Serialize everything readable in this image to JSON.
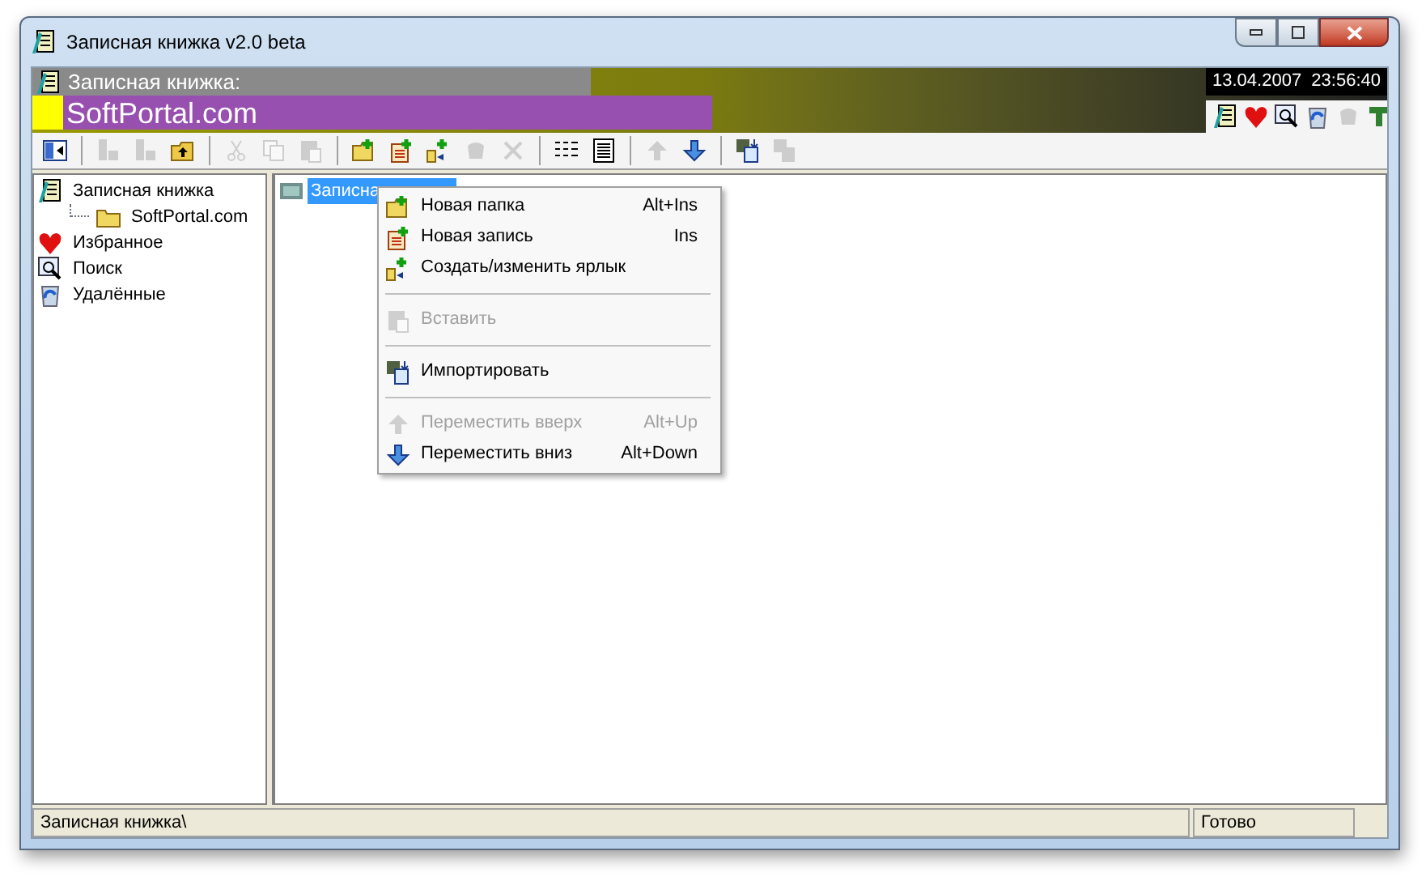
{
  "window": {
    "title": "Записная книжка v2.0 beta"
  },
  "banner": {
    "caption": "Записная книжка:",
    "name": "SoftPortal.com",
    "datetime": "13.04.2007  23:56:40"
  },
  "quick_bar": [
    {
      "kind": "notebook",
      "disabled": false
    },
    {
      "kind": "heart",
      "disabled": false
    },
    {
      "kind": "search",
      "disabled": false
    },
    {
      "kind": "recycle",
      "disabled": false
    },
    {
      "kind": "blob",
      "disabled": true
    },
    {
      "kind": "tool",
      "disabled": false
    }
  ],
  "toolbar": [
    {
      "kind": "panel",
      "disabled": false
    },
    {
      "kind": "sep"
    },
    {
      "kind": "move-down",
      "disabled": true
    },
    {
      "kind": "move-up",
      "disabled": true
    },
    {
      "kind": "folder-up",
      "disabled": false
    },
    {
      "kind": "sep"
    },
    {
      "kind": "cut",
      "disabled": true
    },
    {
      "kind": "copy",
      "disabled": true
    },
    {
      "kind": "paste",
      "disabled": true
    },
    {
      "kind": "sep"
    },
    {
      "kind": "new-folder",
      "disabled": false
    },
    {
      "kind": "new-record",
      "disabled": false
    },
    {
      "kind": "shortcut",
      "disabled": false
    },
    {
      "kind": "blob",
      "disabled": true
    },
    {
      "kind": "delete",
      "disabled": true
    },
    {
      "kind": "sep"
    },
    {
      "kind": "list",
      "disabled": false
    },
    {
      "kind": "details",
      "disabled": false
    },
    {
      "kind": "sep"
    },
    {
      "kind": "up",
      "disabled": true
    },
    {
      "kind": "down",
      "disabled": false
    },
    {
      "kind": "sep"
    },
    {
      "kind": "import",
      "disabled": false
    },
    {
      "kind": "export",
      "disabled": true
    }
  ],
  "tree": [
    {
      "label": "Записная книжка",
      "selected": false,
      "children": [
        {
          "label": "SoftPortal.com",
          "selected": false
        }
      ]
    },
    {
      "label": "Избранное",
      "selected": false
    },
    {
      "label": "Поиск",
      "selected": false
    },
    {
      "label": "Удалённые",
      "selected": false
    }
  ],
  "list": [
    {
      "label": "Записна",
      "selected": true
    }
  ],
  "context_menu": [
    {
      "kind": "item",
      "label": "Новая папка",
      "shortcut": "Alt+Ins",
      "disabled": false
    },
    {
      "kind": "item",
      "label": "Новая запись",
      "shortcut": "Ins",
      "disabled": false
    },
    {
      "kind": "item",
      "label": "Создать/изменить ярлык",
      "disabled": false
    },
    {
      "kind": "sep"
    },
    {
      "kind": "item",
      "label": "Вставить",
      "disabled": true
    },
    {
      "kind": "sep"
    },
    {
      "kind": "item",
      "label": "Импортировать",
      "disabled": false
    },
    {
      "kind": "sep"
    },
    {
      "kind": "item",
      "label": "Переместить вверх",
      "shortcut": "Alt+Up",
      "disabled": true
    },
    {
      "kind": "item",
      "label": "Переместить вниз",
      "shortcut": "Alt+Down",
      "disabled": false
    }
  ],
  "status_bar": [
    "Записная книжка\\",
    "Готово"
  ]
}
